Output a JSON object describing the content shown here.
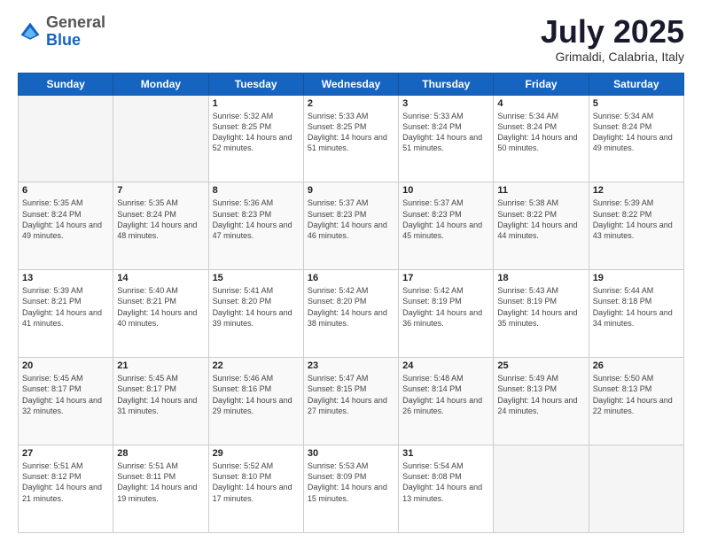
{
  "header": {
    "logo_general": "General",
    "logo_blue": "Blue",
    "month_title": "July 2025",
    "subtitle": "Grimaldi, Calabria, Italy"
  },
  "days_of_week": [
    "Sunday",
    "Monday",
    "Tuesday",
    "Wednesday",
    "Thursday",
    "Friday",
    "Saturday"
  ],
  "weeks": [
    [
      {
        "day": "",
        "content": ""
      },
      {
        "day": "",
        "content": ""
      },
      {
        "day": "1",
        "content": "Sunrise: 5:32 AM\nSunset: 8:25 PM\nDaylight: 14 hours and 52 minutes."
      },
      {
        "day": "2",
        "content": "Sunrise: 5:33 AM\nSunset: 8:25 PM\nDaylight: 14 hours and 51 minutes."
      },
      {
        "day": "3",
        "content": "Sunrise: 5:33 AM\nSunset: 8:24 PM\nDaylight: 14 hours and 51 minutes."
      },
      {
        "day": "4",
        "content": "Sunrise: 5:34 AM\nSunset: 8:24 PM\nDaylight: 14 hours and 50 minutes."
      },
      {
        "day": "5",
        "content": "Sunrise: 5:34 AM\nSunset: 8:24 PM\nDaylight: 14 hours and 49 minutes."
      }
    ],
    [
      {
        "day": "6",
        "content": "Sunrise: 5:35 AM\nSunset: 8:24 PM\nDaylight: 14 hours and 49 minutes."
      },
      {
        "day": "7",
        "content": "Sunrise: 5:35 AM\nSunset: 8:24 PM\nDaylight: 14 hours and 48 minutes."
      },
      {
        "day": "8",
        "content": "Sunrise: 5:36 AM\nSunset: 8:23 PM\nDaylight: 14 hours and 47 minutes."
      },
      {
        "day": "9",
        "content": "Sunrise: 5:37 AM\nSunset: 8:23 PM\nDaylight: 14 hours and 46 minutes."
      },
      {
        "day": "10",
        "content": "Sunrise: 5:37 AM\nSunset: 8:23 PM\nDaylight: 14 hours and 45 minutes."
      },
      {
        "day": "11",
        "content": "Sunrise: 5:38 AM\nSunset: 8:22 PM\nDaylight: 14 hours and 44 minutes."
      },
      {
        "day": "12",
        "content": "Sunrise: 5:39 AM\nSunset: 8:22 PM\nDaylight: 14 hours and 43 minutes."
      }
    ],
    [
      {
        "day": "13",
        "content": "Sunrise: 5:39 AM\nSunset: 8:21 PM\nDaylight: 14 hours and 41 minutes."
      },
      {
        "day": "14",
        "content": "Sunrise: 5:40 AM\nSunset: 8:21 PM\nDaylight: 14 hours and 40 minutes."
      },
      {
        "day": "15",
        "content": "Sunrise: 5:41 AM\nSunset: 8:20 PM\nDaylight: 14 hours and 39 minutes."
      },
      {
        "day": "16",
        "content": "Sunrise: 5:42 AM\nSunset: 8:20 PM\nDaylight: 14 hours and 38 minutes."
      },
      {
        "day": "17",
        "content": "Sunrise: 5:42 AM\nSunset: 8:19 PM\nDaylight: 14 hours and 36 minutes."
      },
      {
        "day": "18",
        "content": "Sunrise: 5:43 AM\nSunset: 8:19 PM\nDaylight: 14 hours and 35 minutes."
      },
      {
        "day": "19",
        "content": "Sunrise: 5:44 AM\nSunset: 8:18 PM\nDaylight: 14 hours and 34 minutes."
      }
    ],
    [
      {
        "day": "20",
        "content": "Sunrise: 5:45 AM\nSunset: 8:17 PM\nDaylight: 14 hours and 32 minutes."
      },
      {
        "day": "21",
        "content": "Sunrise: 5:45 AM\nSunset: 8:17 PM\nDaylight: 14 hours and 31 minutes."
      },
      {
        "day": "22",
        "content": "Sunrise: 5:46 AM\nSunset: 8:16 PM\nDaylight: 14 hours and 29 minutes."
      },
      {
        "day": "23",
        "content": "Sunrise: 5:47 AM\nSunset: 8:15 PM\nDaylight: 14 hours and 27 minutes."
      },
      {
        "day": "24",
        "content": "Sunrise: 5:48 AM\nSunset: 8:14 PM\nDaylight: 14 hours and 26 minutes."
      },
      {
        "day": "25",
        "content": "Sunrise: 5:49 AM\nSunset: 8:13 PM\nDaylight: 14 hours and 24 minutes."
      },
      {
        "day": "26",
        "content": "Sunrise: 5:50 AM\nSunset: 8:13 PM\nDaylight: 14 hours and 22 minutes."
      }
    ],
    [
      {
        "day": "27",
        "content": "Sunrise: 5:51 AM\nSunset: 8:12 PM\nDaylight: 14 hours and 21 minutes."
      },
      {
        "day": "28",
        "content": "Sunrise: 5:51 AM\nSunset: 8:11 PM\nDaylight: 14 hours and 19 minutes."
      },
      {
        "day": "29",
        "content": "Sunrise: 5:52 AM\nSunset: 8:10 PM\nDaylight: 14 hours and 17 minutes."
      },
      {
        "day": "30",
        "content": "Sunrise: 5:53 AM\nSunset: 8:09 PM\nDaylight: 14 hours and 15 minutes."
      },
      {
        "day": "31",
        "content": "Sunrise: 5:54 AM\nSunset: 8:08 PM\nDaylight: 14 hours and 13 minutes."
      },
      {
        "day": "",
        "content": ""
      },
      {
        "day": "",
        "content": ""
      }
    ]
  ]
}
